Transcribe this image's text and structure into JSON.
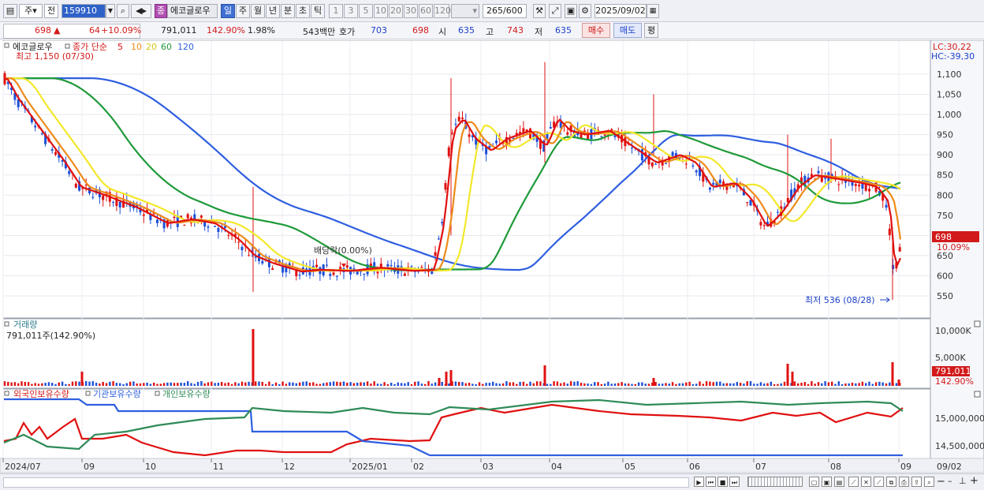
{
  "toolbar": {
    "market_type": "주",
    "prev_label": "전",
    "code": "159910",
    "name": "에코글로우",
    "jong_badge": "종",
    "periods": [
      "일",
      "주",
      "월",
      "년",
      "분",
      "초",
      "틱"
    ],
    "active_period": "일",
    "intervals": [
      "1",
      "3",
      "5",
      "10",
      "20",
      "30",
      "60",
      "120"
    ],
    "count_value": "265",
    "count_max": "/600",
    "date_value": "2025/09/02"
  },
  "quote": {
    "price": "698",
    "change_mark": "▲",
    "change": "64",
    "change_rate": "+10.09%",
    "volume": "791,011",
    "volume_ratio": "142.90%",
    "turnover": "1.98%",
    "amount": "543백만",
    "hoga_label": "호가",
    "ask": "703",
    "bid": "698",
    "open_label": "시",
    "open": "635",
    "high_label": "고",
    "high": "743",
    "low_label": "저",
    "low": "635",
    "buy_label": "매수",
    "sell_label": "매도",
    "pyeong_label": "평"
  },
  "price_panel": {
    "legend_name": "에코글로우",
    "legend_ma": "종가 단순",
    "ma_periods": [
      "5",
      "10",
      "20",
      "60",
      "120"
    ],
    "ma_colors": [
      "#e01010",
      "#ee8a1a",
      "#f2e82a",
      "#1f9a3a",
      "#2f5fe0"
    ],
    "highest_label": "최고 1,150 (07/30)",
    "lowest_label": "최저 536 (08/28)",
    "dividend_label": "배당락(0.00%)",
    "lc_label": "LC:30,22",
    "hc_label": "HC:-39,30",
    "current_price_tag": "698",
    "current_rate_tag": "10.09%",
    "y_ticks": [
      "1,100",
      "1,050",
      "1,000",
      "950",
      "900",
      "850",
      "800",
      "750",
      "700",
      "650",
      "600",
      "550"
    ]
  },
  "volume_panel": {
    "title": "거래량",
    "summary": "791,011주(142.90%)",
    "y_ticks": [
      "10,000K",
      "5,000K"
    ],
    "current_tag": "791,011",
    "rate_tag": "142.90%"
  },
  "holding_panel": {
    "series": [
      "외국인보유수량",
      "기관보유수량",
      "개인보유수량"
    ],
    "colors": [
      "#e01010",
      "#2f5fe0",
      "#2e8b57"
    ],
    "y_ticks": [
      "15,000,000",
      "14,500,000"
    ]
  },
  "x_axis": {
    "labels": [
      "2024/07",
      "09",
      "10",
      "11",
      "12",
      "2025/01",
      "02",
      "03",
      "04",
      "05",
      "06",
      "07",
      "08",
      "09"
    ],
    "right_label": "09/02"
  }
}
